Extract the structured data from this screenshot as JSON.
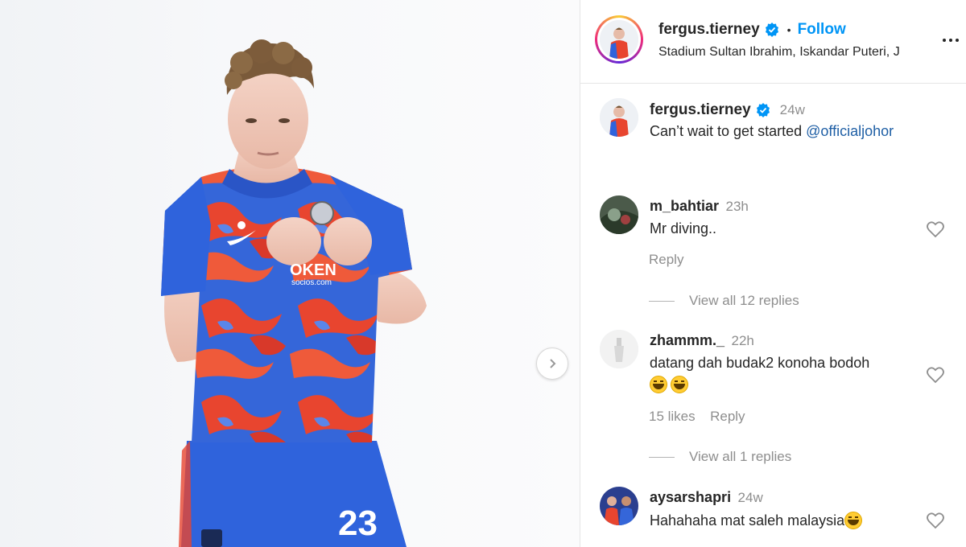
{
  "post": {
    "author": "fergus.tierney",
    "follow_label": "Follow",
    "separator": "•",
    "location": "Stadium Sultan Ibrahim, Iskandar Puteri, J",
    "caption_prefix": "Can’t wait to get started ",
    "caption_mention": "@officialjohor",
    "caption_time": "24w",
    "photo": {
      "sponsor_text": "OKEN",
      "sponsor_sub": "socios.com",
      "jersey_number": "23"
    }
  },
  "comments": [
    {
      "username": "m_bahtiar",
      "time": "23h",
      "text": "Mr diving..",
      "likes": "",
      "reply_label": "Reply",
      "view_replies": "View all 12 replies"
    },
    {
      "username": "zhammm._",
      "time": "22h",
      "text": "datang dah budak2 konoha bodoh",
      "emojis": "😆😆",
      "likes": "15 likes",
      "reply_label": "Reply",
      "view_replies": "View all 1 replies"
    },
    {
      "username": "aysarshapri",
      "time": "24w",
      "text": "Hahahaha mat saleh malaysia",
      "emojis": "😆"
    }
  ],
  "icons": {
    "verified": "verified-badge-icon",
    "more": "more-options-icon",
    "heart": "heart-icon",
    "next": "chevron-right-icon"
  },
  "colors": {
    "accent": "#0095f6",
    "verified": "#0095f6",
    "jersey_blue": "#2e5fd6",
    "jersey_red": "#e8452f"
  }
}
